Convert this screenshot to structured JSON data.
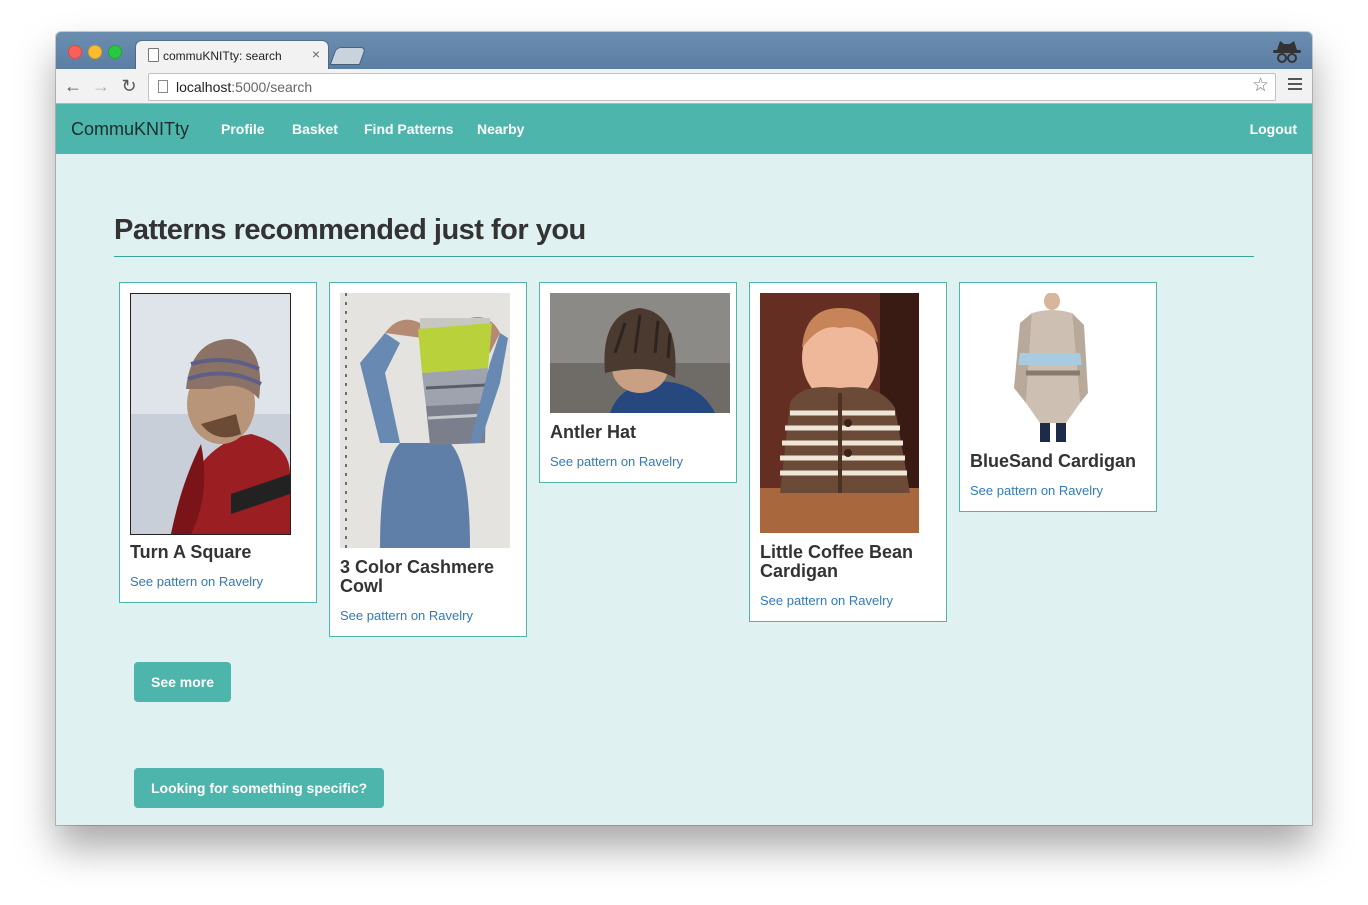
{
  "browser": {
    "tab_title": "commuKNITty: search",
    "tab_close": "×",
    "url_host": "localhost",
    "url_rest": ":5000/search",
    "back_glyph": "←",
    "forward_glyph": "→",
    "reload_glyph": "↻",
    "star_glyph": "☆"
  },
  "navbar": {
    "brand": "CommuKNITty",
    "links": [
      "Profile",
      "Basket",
      "Find Patterns",
      "Nearby"
    ],
    "logout": "Logout",
    "color": "#4db5ab"
  },
  "main": {
    "heading": "Patterns recommended just for you",
    "patterns": [
      {
        "title": "Turn A Square",
        "link": "See pattern on Ravelry"
      },
      {
        "title": "3 Color Cashmere Cowl",
        "link": "See pattern on Ravelry"
      },
      {
        "title": "Antler Hat",
        "link": "See pattern on Ravelry"
      },
      {
        "title": "Little Coffee Bean Cardigan",
        "link": "See pattern on Ravelry"
      },
      {
        "title": "BlueSand Cardigan",
        "link": "See pattern on Ravelry"
      }
    ],
    "see_more": "See more",
    "specific": "Looking for something specific?"
  },
  "colors": {
    "accent": "#4db5ab",
    "page_background": "#dff1f0",
    "link": "#337ab7"
  }
}
